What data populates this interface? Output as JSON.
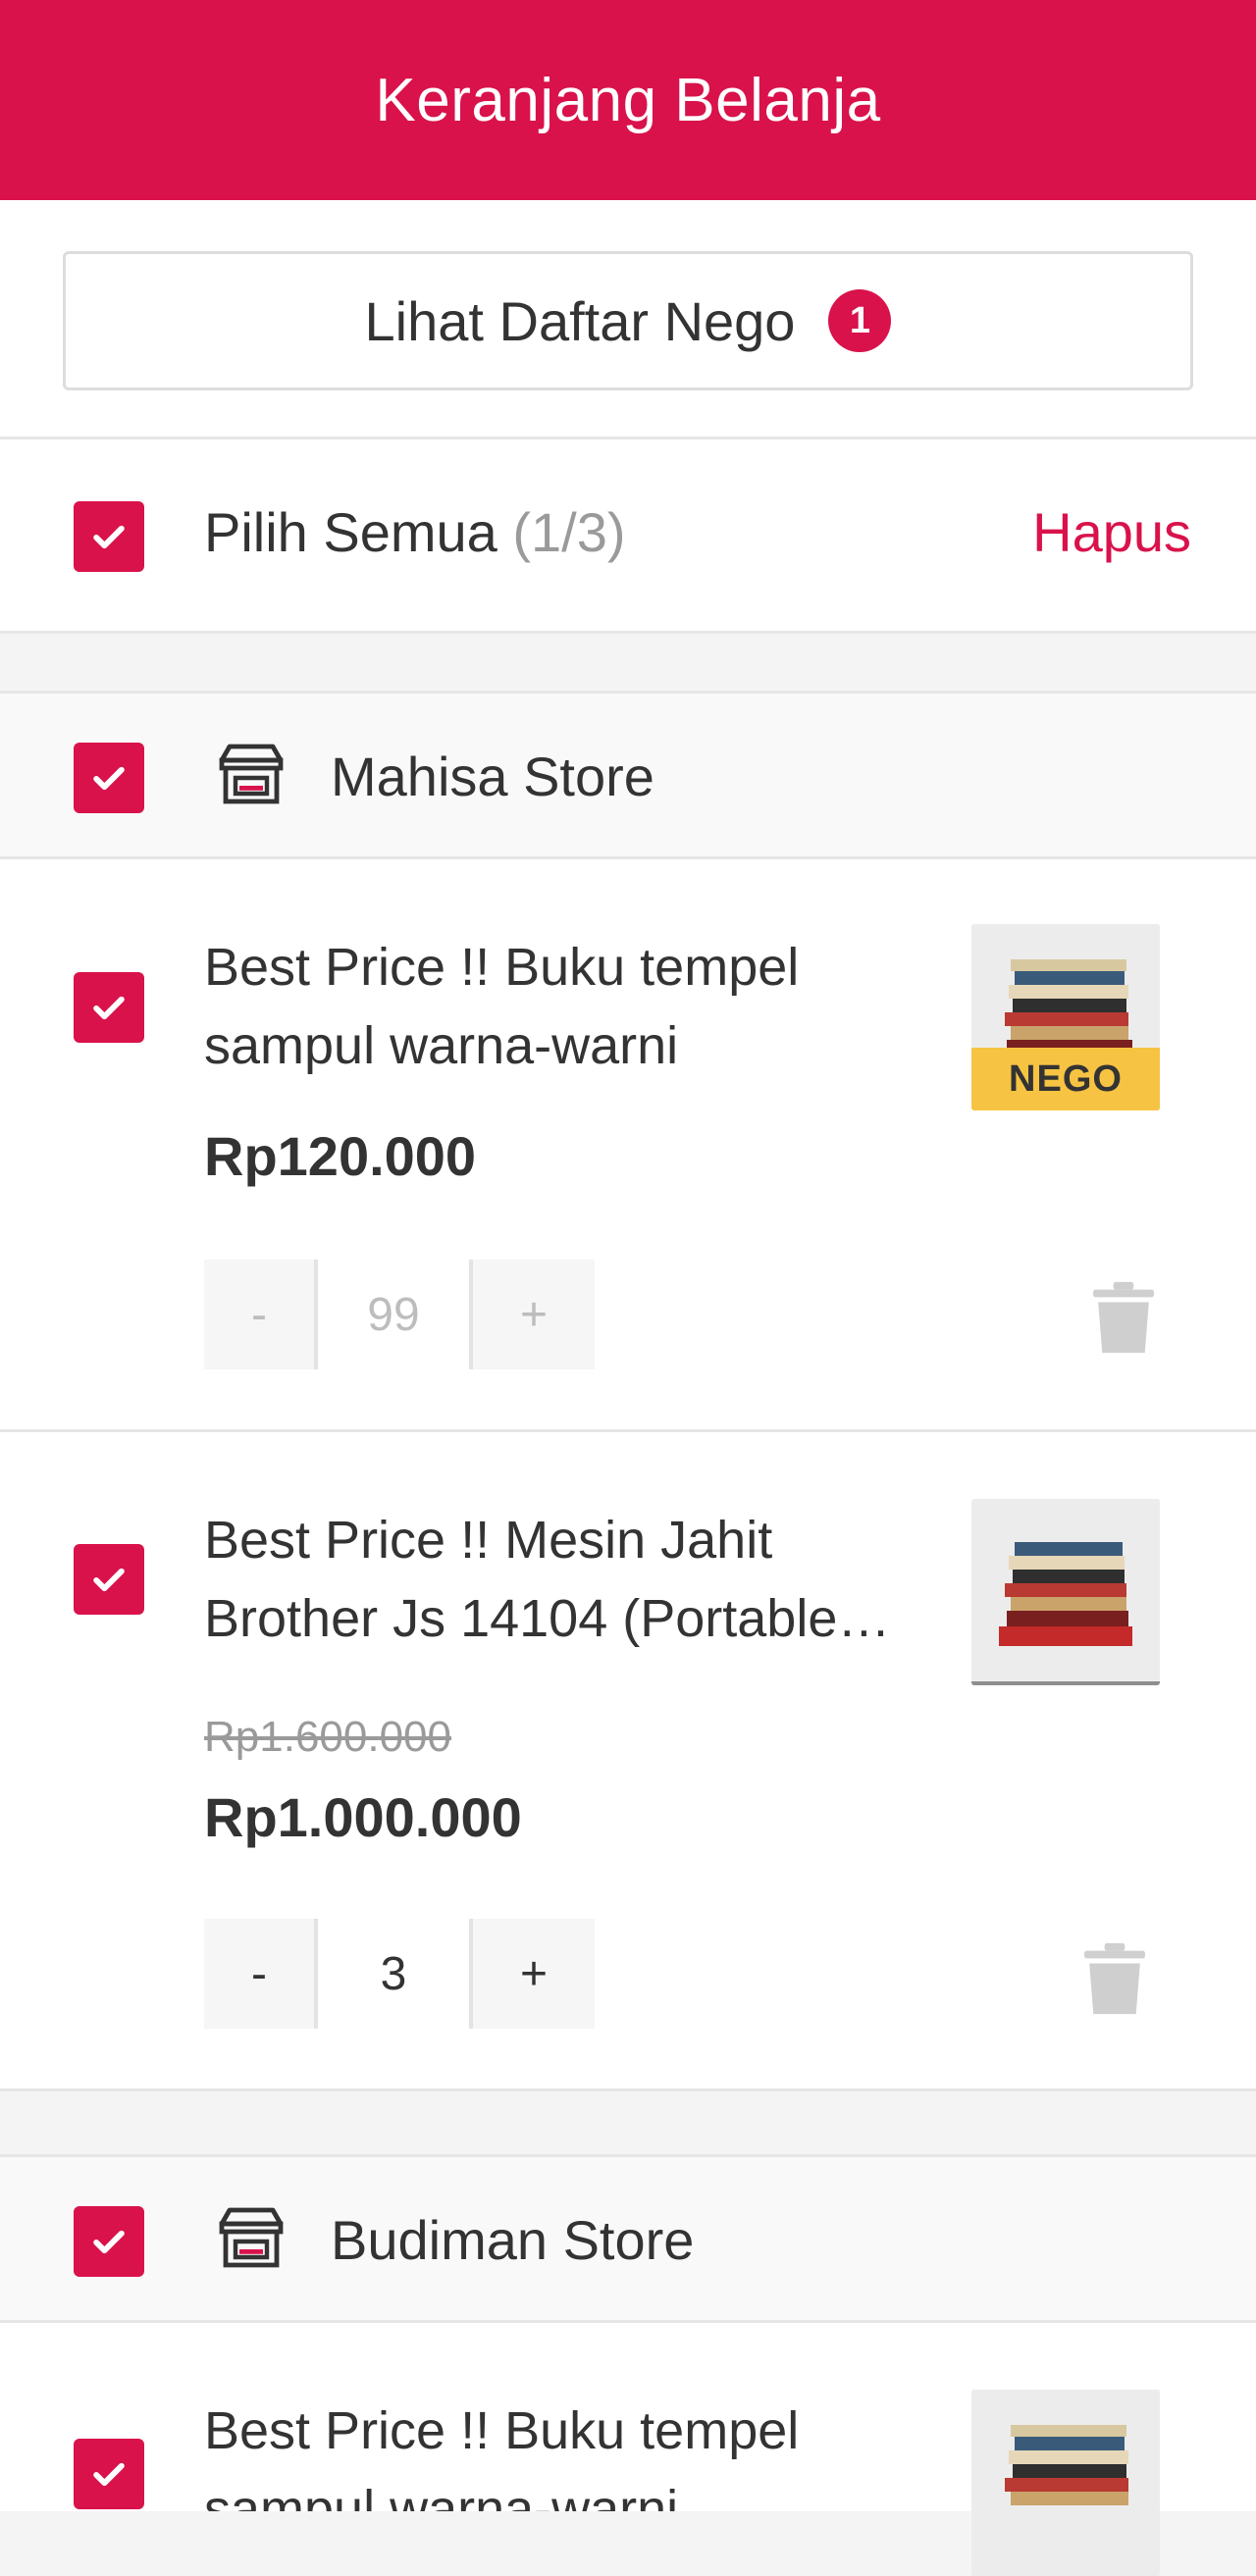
{
  "header": {
    "title": "Keranjang Belanja"
  },
  "nego": {
    "label": "Lihat Daftar Nego",
    "badge": "1"
  },
  "select_all": {
    "label": "Pilih Semua",
    "count": "(1/3)",
    "delete": "Hapus"
  },
  "stores": [
    {
      "name": "Mahisa Store",
      "items": [
        {
          "name": "Best Price !! Buku tempel\nsampul warna-warni",
          "price": "Rp120.000",
          "nego_tag": "NEGO",
          "qty": "99",
          "minus": "-",
          "plus": "+"
        },
        {
          "name": "Best Price !! Mesin Jahit\nBrother Js 14104 (Portable…",
          "old_price": "Rp1.600.000",
          "price": "Rp1.000.000",
          "qty": "3",
          "minus": "-",
          "plus": "+"
        }
      ]
    },
    {
      "name": "Budiman Store",
      "items": [
        {
          "name": "Best Price !! Buku tempel\nsampul warna-warni"
        }
      ]
    }
  ],
  "colors": {
    "accent": "#d9124b",
    "nego_tag": "#f6c343"
  }
}
